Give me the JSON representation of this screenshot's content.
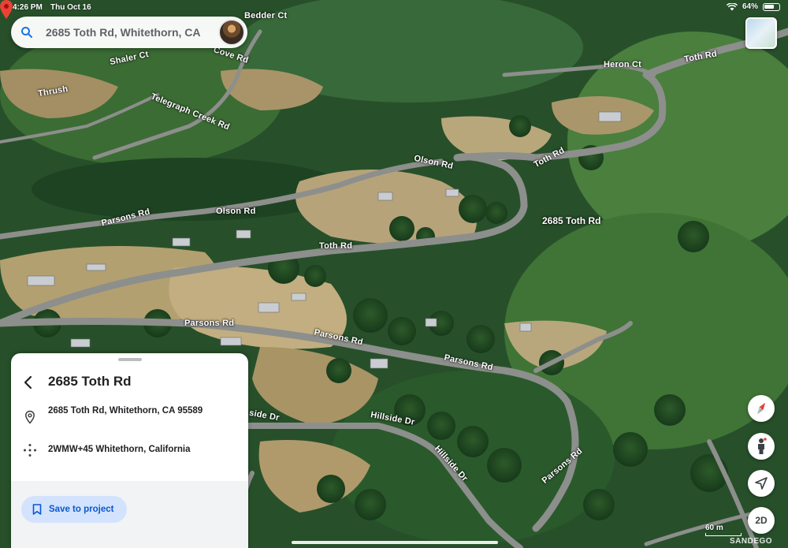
{
  "status_bar": {
    "time": "4:26 PM",
    "date": "Thu Oct 16",
    "battery": "64%"
  },
  "search": {
    "query": "2685 Toth Rd, Whitethorn, CA"
  },
  "map": {
    "pin_label": "2685 Toth Rd",
    "scale_label": "60 m",
    "watermark": "SANDEGO",
    "road_labels": {
      "bedder_ct": "Bedder Ct",
      "shaler_ct": "Shaler Ct",
      "thrush": "Thrush",
      "cove_rd": "Cove Rd",
      "telegraph_creek_rd": "Telegraph Creek Rd",
      "heron_ct": "Heron Ct",
      "toth_rd_top": "Toth Rd",
      "olson_rd_upper": "Olson Rd",
      "toth_rd_mid": "Toth Rd",
      "parsons_rd_left": "Parsons Rd",
      "olson_rd_left": "Olson Rd",
      "toth_rd_center": "Toth Rd",
      "parsons_rd_center": "Parsons Rd",
      "parsons_rd_lower": "Parsons Rd",
      "parsons_rd_right": "Parsons Rd",
      "hillside_dr": "Hillside Dr",
      "hillside_dr_2": "Hillside Dr",
      "parsons_rd_bottom": "Parsons Rd",
      "side_dr": "side Dr"
    }
  },
  "info_sheet": {
    "title": "2685 Toth Rd",
    "address": "2685 Toth Rd, Whitethorn, CA 95589",
    "plus_code": "2WMW+45 Whitethorn, California",
    "save_label": "Save to project"
  },
  "controls": {
    "twod_label": "2D"
  },
  "colors": {
    "accent": "#0b57d0",
    "button_bg": "#d3e3fd",
    "pin": "#ea4335"
  }
}
